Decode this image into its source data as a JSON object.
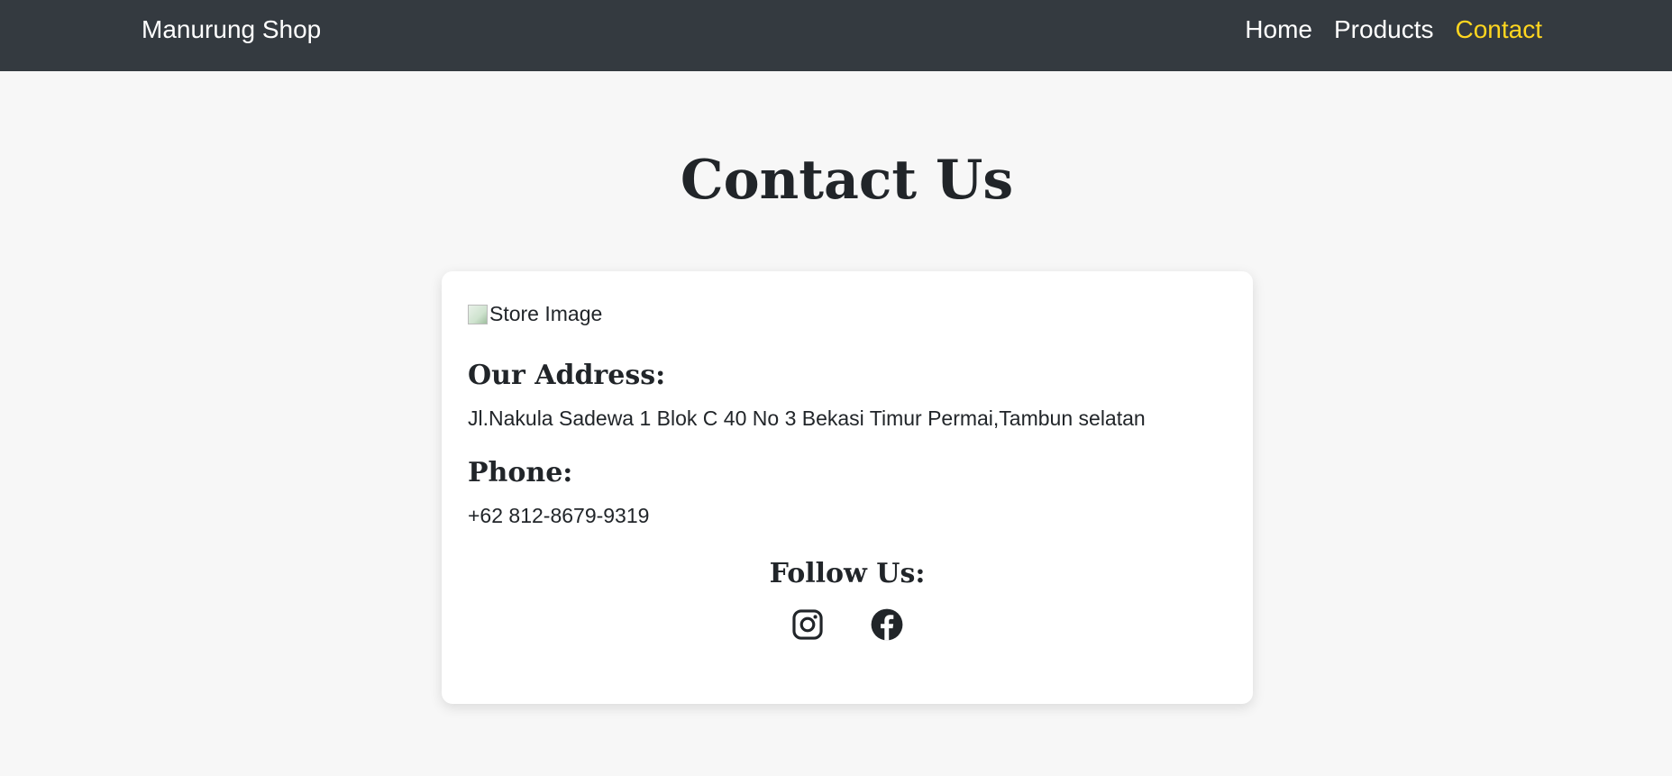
{
  "navbar": {
    "brand": "Manurung Shop",
    "links": [
      {
        "label": "Home",
        "active": false
      },
      {
        "label": "Products",
        "active": false
      },
      {
        "label": "Contact",
        "active": true
      }
    ]
  },
  "page": {
    "title": "Contact Us"
  },
  "card": {
    "image_alt": "Store Image",
    "address_heading": "Our Address:",
    "address_text": "Jl.Nakula Sadewa 1 Blok C 40 No 3 Bekasi Timur Permai,Tambun selatan",
    "phone_heading": "Phone:",
    "phone_text": "+62 812-8679-9319",
    "follow_heading": "Follow Us:",
    "social": [
      {
        "icon": "instagram-icon"
      },
      {
        "icon": "facebook-icon"
      }
    ]
  },
  "colors": {
    "navbar_bg": "#343a40",
    "active_link": "#ffd61f",
    "page_bg": "#f7f7f7",
    "text": "#212529"
  }
}
